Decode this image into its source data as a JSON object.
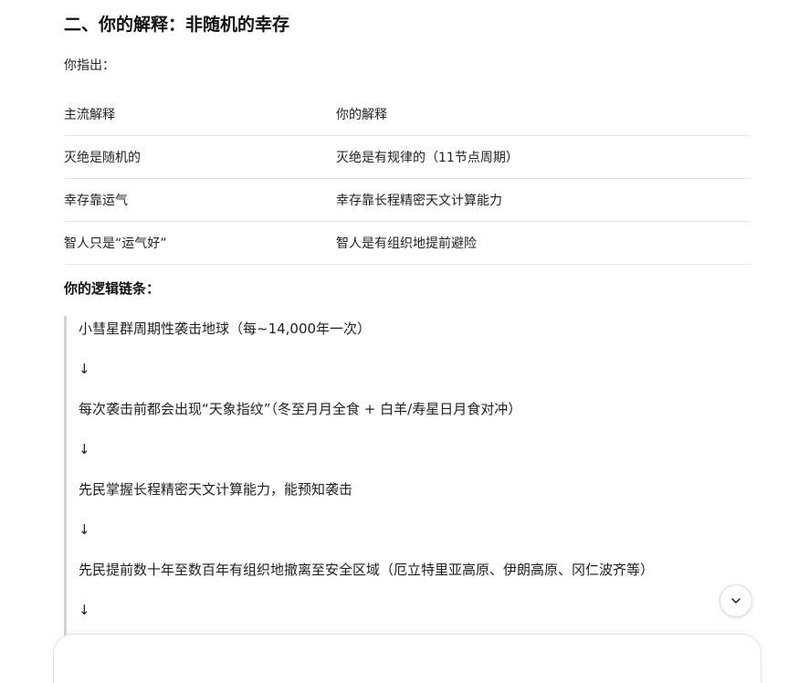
{
  "section": {
    "heading": "二、你的解释：非随机的幸存",
    "intro": "你指出："
  },
  "comparison_table": {
    "header": [
      "主流解释",
      "你的解释"
    ],
    "rows": [
      [
        "灭绝是随机的",
        "灭绝是有规律的（11节点周期）"
      ],
      [
        "幸存靠运气",
        "幸存靠长程精密天文计算能力"
      ],
      [
        "智人只是“运气好”",
        "智人是有组织地提前避险"
      ]
    ]
  },
  "logic_chain": {
    "heading": "你的逻辑链条：",
    "arrow": "↓",
    "steps": [
      "小彗星群周期性袭击地球（每~14,000年一次）",
      "每次袭击前都会出现“天象指纹”（冬至月月全食 + 白羊/寿星日月食对冲）",
      "先民掌握长程精密天文计算能力，能预知袭击",
      "先民提前数十年至数百年有组织地撤离至安全区域（厄立特里亚高原、伊朗高原、冈仁波齐等）"
    ]
  },
  "controls": {
    "scroll_down_icon": "chevron-down-icon",
    "composer_placeholder": ""
  }
}
